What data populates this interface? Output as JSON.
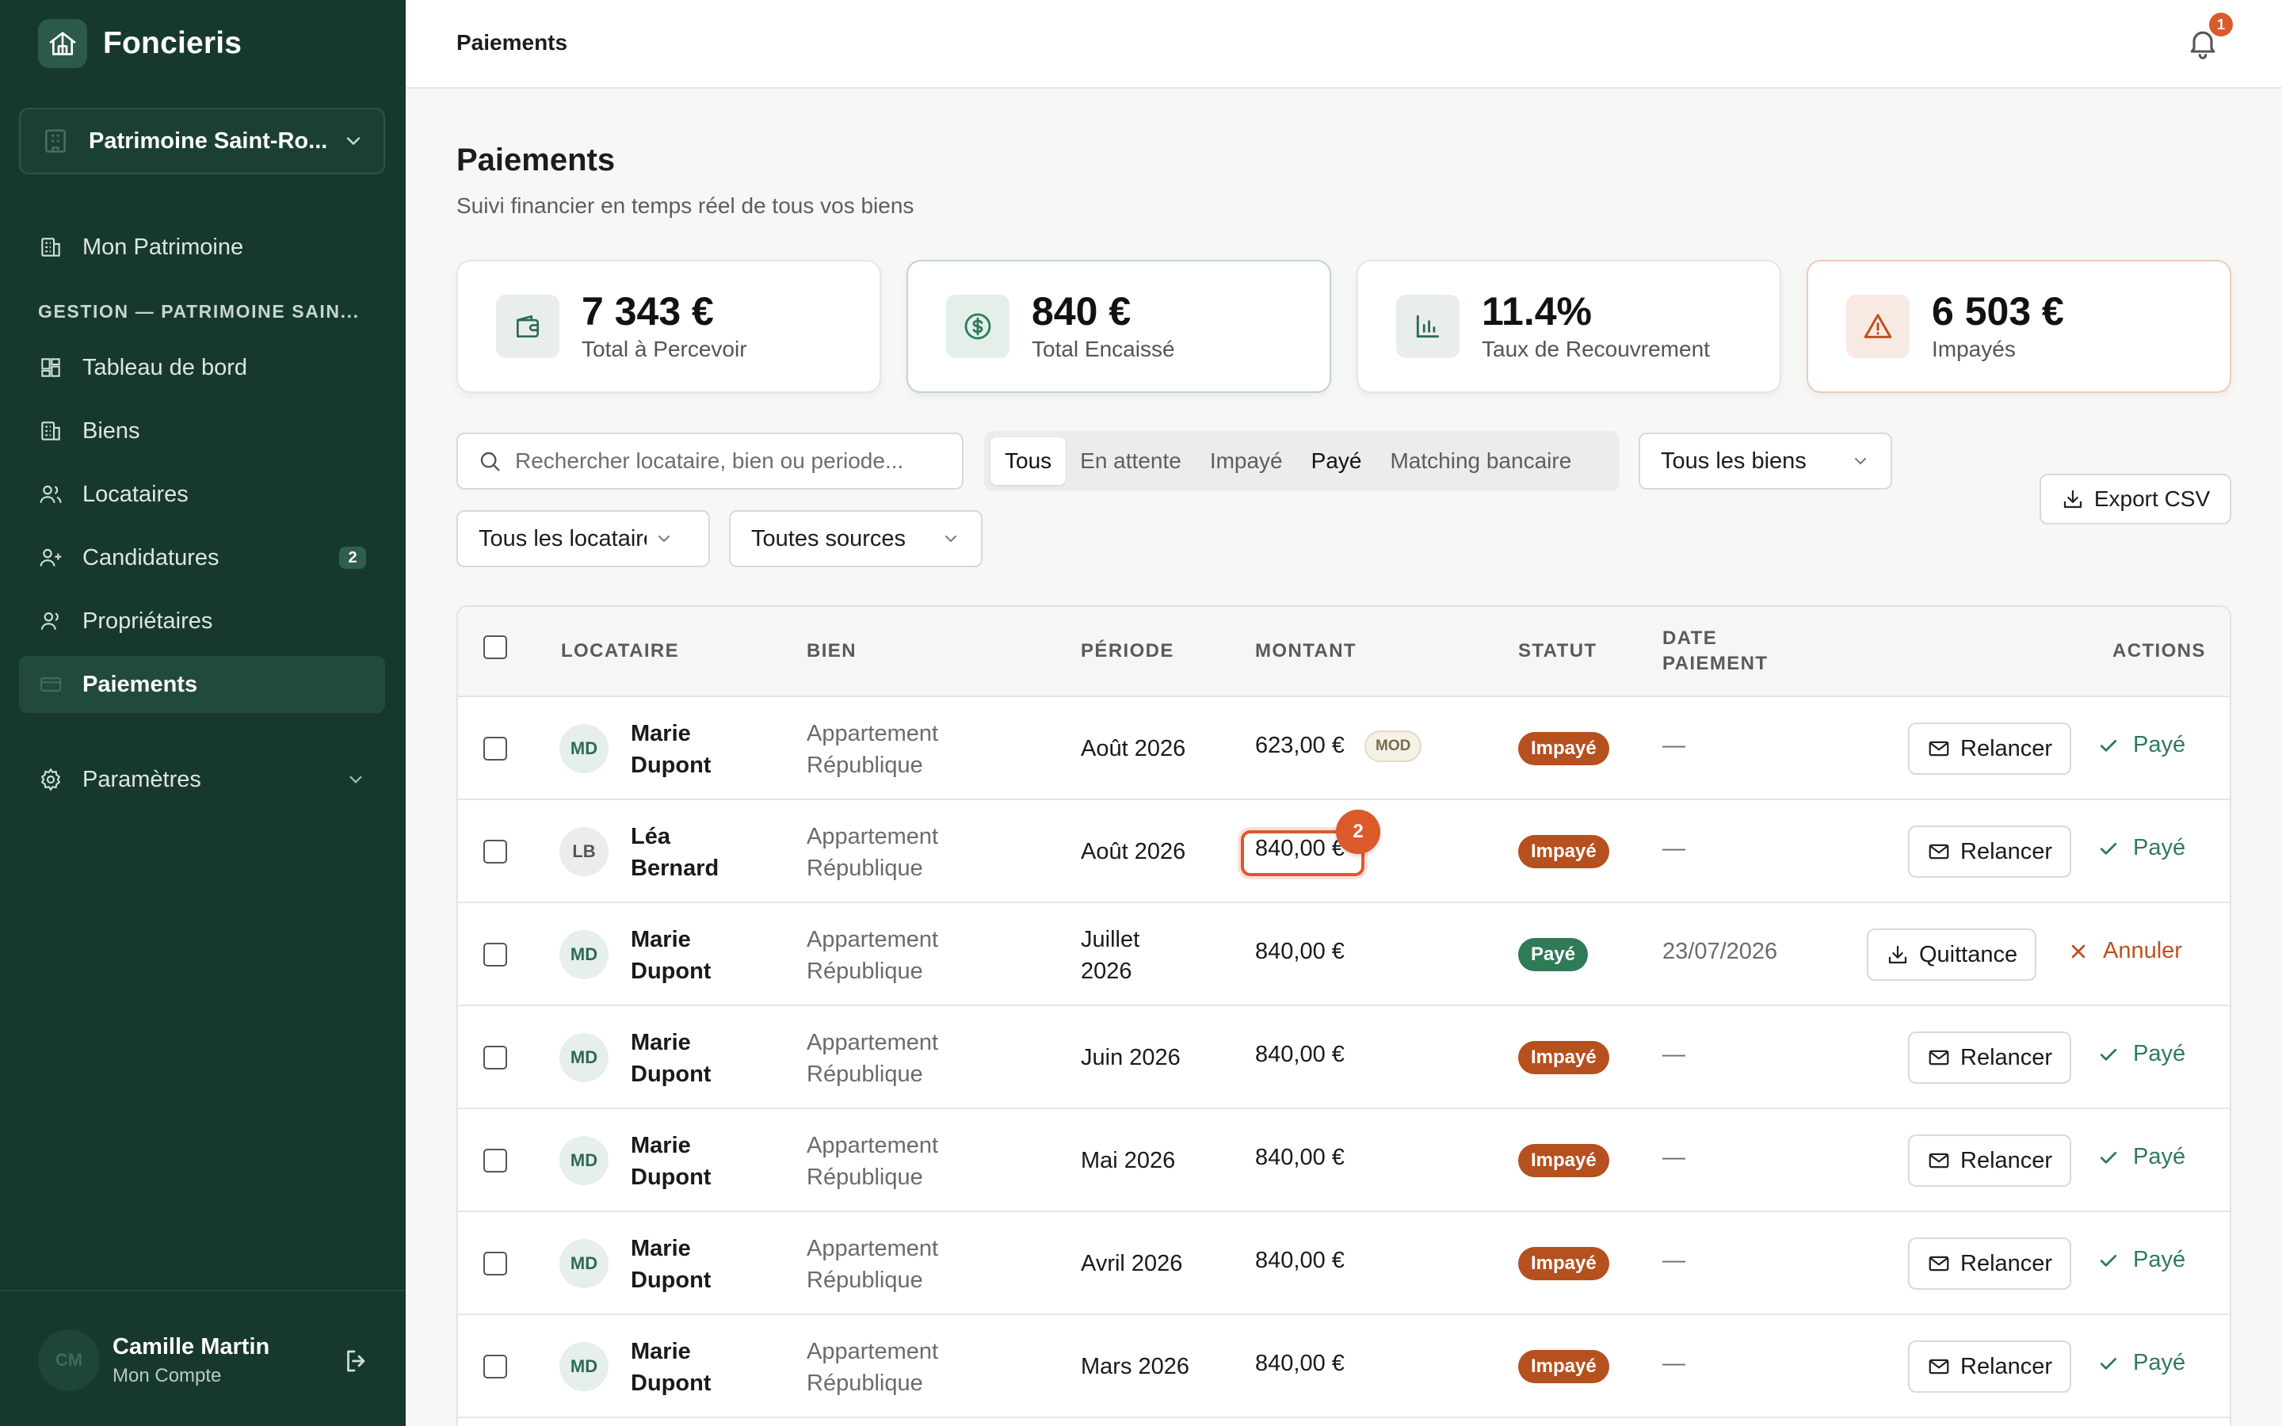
{
  "app": {
    "name": "Foncieris",
    "workspace": "Patrimoine Saint-Ro..."
  },
  "sidebar": {
    "top_item": "Mon Patrimoine",
    "section_label": "GESTION — PATRIMOINE SAIN...",
    "items": [
      {
        "label": "Tableau de bord",
        "icon": "dashboard-icon"
      },
      {
        "label": "Biens",
        "icon": "building-icon"
      },
      {
        "label": "Locataires",
        "icon": "users-icon"
      },
      {
        "label": "Candidatures",
        "icon": "user-plus-icon",
        "badge": "2"
      },
      {
        "label": "Propriétaires",
        "icon": "user-icon"
      },
      {
        "label": "Paiements",
        "icon": "credit-card-icon",
        "active": true
      }
    ],
    "settings": "Paramètres",
    "user": {
      "initials": "CM",
      "name": "Camille Martin",
      "subtitle": "Mon Compte"
    }
  },
  "topbar": {
    "title": "Paiements",
    "notifications": "1"
  },
  "header": {
    "title": "Paiements",
    "subtitle": "Suivi financier en temps réel de tous vos biens"
  },
  "kpis": [
    {
      "value": "7 343 €",
      "label": "Total à Percevoir",
      "icon": "wallet-icon"
    },
    {
      "value": "840 €",
      "label": "Total Encaissé",
      "icon": "dollar-circle-icon"
    },
    {
      "value": "11.4%",
      "label": "Taux de Recouvrement",
      "icon": "bar-chart-icon"
    },
    {
      "value": "6 503 €",
      "label": "Impayés",
      "icon": "warning-icon"
    }
  ],
  "filters": {
    "search_placeholder": "Rechercher locataire, bien ou periode...",
    "tabs": [
      "Tous",
      "En attente",
      "Impayé",
      "Payé",
      "Matching bancaire"
    ],
    "active_tab": "Tous",
    "biens_select": "Tous les biens",
    "locataires_select": "Tous les locataires",
    "sources_select": "Toutes sources",
    "export_label": "Export CSV"
  },
  "table": {
    "headers": {
      "locataire": "LOCATAIRE",
      "bien": "BIEN",
      "periode": "PÉRIODE",
      "montant": "MONTANT",
      "statut": "STATUT",
      "date_line1": "DATE",
      "date_line2": "PAIEMENT",
      "actions": "ACTIONS"
    },
    "rows": [
      {
        "initials": "MD",
        "first": "Marie",
        "last": "Dupont",
        "bien1": "Appartement",
        "bien2": "République",
        "periode": "Août 2026",
        "montant": "623,00 €",
        "tag": "MOD",
        "statut": "Impayé",
        "date": "—",
        "action": "Relancer",
        "secondary": "Payé"
      },
      {
        "initials": "LB",
        "first": "Léa",
        "last": "Bernard",
        "bien1": "Appartement",
        "bien2": "République",
        "periode": "Août 2026",
        "montant": "840,00 €",
        "highlight": "2",
        "statut": "Impayé",
        "date": "—",
        "action": "Relancer",
        "secondary": "Payé"
      },
      {
        "initials": "MD",
        "first": "Marie",
        "last": "Dupont",
        "bien1": "Appartement",
        "bien2": "République",
        "periode": "Juillet 2026",
        "montant": "840,00 €",
        "statut": "Payé",
        "date": "23/07/2026",
        "action": "Quittance",
        "secondary": "Annuler"
      },
      {
        "initials": "MD",
        "first": "Marie",
        "last": "Dupont",
        "bien1": "Appartement",
        "bien2": "République",
        "periode": "Juin 2026",
        "montant": "840,00 €",
        "statut": "Impayé",
        "date": "—",
        "action": "Relancer",
        "secondary": "Payé"
      },
      {
        "initials": "MD",
        "first": "Marie",
        "last": "Dupont",
        "bien1": "Appartement",
        "bien2": "République",
        "periode": "Mai 2026",
        "montant": "840,00 €",
        "statut": "Impayé",
        "date": "—",
        "action": "Relancer",
        "secondary": "Payé"
      },
      {
        "initials": "MD",
        "first": "Marie",
        "last": "Dupont",
        "bien1": "Appartement",
        "bien2": "République",
        "periode": "Avril 2026",
        "montant": "840,00 €",
        "statut": "Impayé",
        "date": "—",
        "action": "Relancer",
        "secondary": "Payé"
      },
      {
        "initials": "MD",
        "first": "Marie",
        "last": "Dupont",
        "bien1": "Appartement",
        "bien2": "République",
        "periode": "Mars 2026",
        "montant": "840,00 €",
        "statut": "Impayé",
        "date": "—",
        "action": "Relancer",
        "secondary": "Payé"
      }
    ]
  },
  "colors": {
    "sidebar_bg": "#17382d",
    "accent_green": "#2f7a57",
    "unpaid": "#b5501f",
    "highlight": "#dc5a2a"
  }
}
